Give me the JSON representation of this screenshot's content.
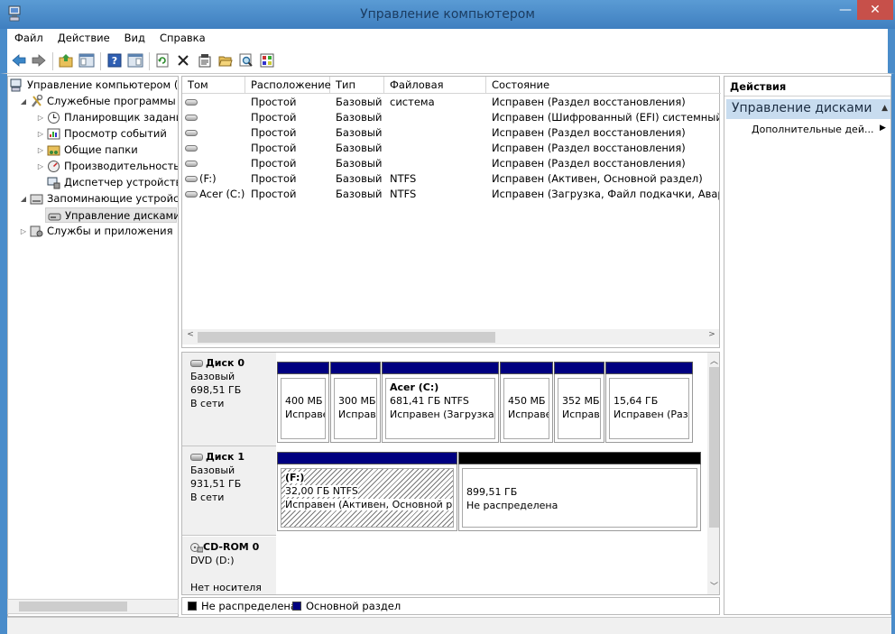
{
  "window": {
    "title": "Управление компьютером",
    "minimize": "—",
    "close": "✕"
  },
  "menu": [
    "Файл",
    "Действие",
    "Вид",
    "Справка"
  ],
  "tree": {
    "root": "Управление компьютером (л",
    "utilities": "Служебные программы",
    "scheduler": "Планировщик заданий",
    "event_viewer": "Просмотр событий",
    "shared_folders": "Общие папки",
    "performance": "Производительность",
    "device_manager": "Диспетчер устройств",
    "storage": "Запоминающие устройст",
    "disk_management": "Управление дисками",
    "services": "Службы и приложения"
  },
  "volumes": {
    "columns": [
      "Том",
      "Расположение",
      "Тип",
      "Файловая система",
      "Состояние"
    ],
    "rows": [
      {
        "vol": "",
        "layout": "Простой",
        "type": "Базовый",
        "fs": "",
        "status": "Исправен (Раздел восстановления)"
      },
      {
        "vol": "",
        "layout": "Простой",
        "type": "Базовый",
        "fs": "",
        "status": "Исправен (Шифрованный (EFI) системный ра"
      },
      {
        "vol": "",
        "layout": "Простой",
        "type": "Базовый",
        "fs": "",
        "status": "Исправен (Раздел восстановления)"
      },
      {
        "vol": "",
        "layout": "Простой",
        "type": "Базовый",
        "fs": "",
        "status": "Исправен (Раздел восстановления)"
      },
      {
        "vol": "",
        "layout": "Простой",
        "type": "Базовый",
        "fs": "",
        "status": "Исправен (Раздел восстановления)"
      },
      {
        "vol": "(F:)",
        "layout": "Простой",
        "type": "Базовый",
        "fs": "NTFS",
        "status": "Исправен (Активен, Основной раздел)"
      },
      {
        "vol": "Acer (C:)",
        "layout": "Простой",
        "type": "Базовый",
        "fs": "NTFS",
        "status": "Исправен (Загрузка, Файл подкачки, Аварийн"
      }
    ]
  },
  "disks": {
    "disk0": {
      "name": "Диск 0",
      "kind": "Базовый",
      "size": "698,51 ГБ",
      "state": "В сети",
      "parts": [
        {
          "line1": "400 МБ",
          "line2": "Исправе"
        },
        {
          "line1": "300 МБ",
          "line2": "Исправ"
        },
        {
          "title": "Acer  (C:)",
          "line1": "681,41 ГБ NTFS",
          "line2": "Исправен (Загрузка,"
        },
        {
          "line1": "450 МБ",
          "line2": "Исправе"
        },
        {
          "line1": "352 МБ",
          "line2": "Исправ"
        },
        {
          "line1": "15,64 ГБ",
          "line2": "Исправен (Раз,"
        }
      ]
    },
    "disk1": {
      "name": "Диск 1",
      "kind": "Базовый",
      "size": "931,51 ГБ",
      "state": "В сети",
      "parts": [
        {
          "title": "(F:)",
          "line1": "32,00 ГБ NTFS",
          "line2": "Исправен (Активен, Основной ра"
        },
        {
          "line1": "899,51 ГБ",
          "line2": "Не распределена"
        }
      ]
    },
    "cdrom0": {
      "name": "CD-ROM 0",
      "drive": "DVD (D:)",
      "media": "Нет носителя"
    }
  },
  "legend": {
    "unallocated": "Не распределена",
    "primary": "Основной раздел",
    "unallocated_color": "#000000",
    "primary_color": "#000080"
  },
  "actions": {
    "header": "Действия",
    "section": "Управление дисками",
    "more": "Дополнительные дей..."
  }
}
